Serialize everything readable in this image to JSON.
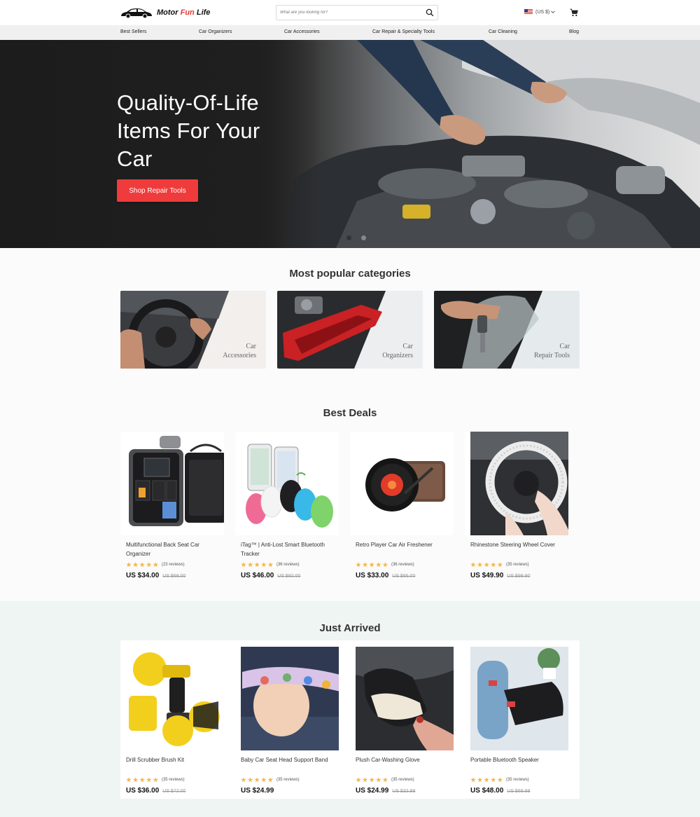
{
  "header": {
    "logo": {
      "word1": "Motor",
      "word2": "Fun",
      "word3": "Life"
    },
    "search": {
      "placeholder": "What are you looking for?",
      "icon": "search-icon"
    },
    "currency": "(US $)",
    "cart_icon": "cart-icon"
  },
  "nav": {
    "items": [
      "Best Sellers",
      "Car Organizers",
      "Car Accessories",
      "Car Repair & Specialty Tools",
      "Car Cleaning",
      "Blog"
    ]
  },
  "hero": {
    "title": "Quality-Of-Life Items For Your Car",
    "cta": "Shop Repair Tools",
    "slides": 2,
    "active_slide": 1
  },
  "categories": {
    "title": "Most popular categories",
    "items": [
      {
        "line1": "Car",
        "line2": "Accessories"
      },
      {
        "line1": "Car",
        "line2": "Organizers"
      },
      {
        "line1": "Car",
        "line2": "Repair Tools"
      }
    ]
  },
  "best_deals": {
    "title": "Best Deals",
    "products": [
      {
        "name": "Multifunctional Back Seat Car Organizer",
        "rating": 5,
        "reviews": "(23 reviews)",
        "price": "US $34.00",
        "old_price": "US $68.00"
      },
      {
        "name": "iTag™ | Anti-Lost Smart Bluetooth Tracker",
        "rating": 5,
        "reviews": "(36 reviews)",
        "price": "US $46.00",
        "old_price": "US $92.00"
      },
      {
        "name": "Retro Player Car Air Freshener",
        "rating": 5,
        "reviews": "(36 reviews)",
        "price": "US $33.00",
        "old_price": "US $66.00"
      },
      {
        "name": "Rhinestone Steering Wheel Cover",
        "rating": 5,
        "reviews": "(35 reviews)",
        "price": "US $49.90",
        "old_price": "US $99.90"
      }
    ]
  },
  "just_arrived": {
    "title": "Just Arrived",
    "products": [
      {
        "name": "Drill Scrubber Brush Kit",
        "rating": 5,
        "reviews": "(35 reviews)",
        "price": "US $36.00",
        "old_price": "US $72.00"
      },
      {
        "name": "Baby Car Seat Head Support Band",
        "rating": 5,
        "reviews": "(35 reviews)",
        "price": "US $24.99",
        "old_price": ""
      },
      {
        "name": "Plush Car-Washing Glove",
        "rating": 5,
        "reviews": "(35 reviews)",
        "price": "US $24.99",
        "old_price": "US $32.99"
      },
      {
        "name": "Portable Bluetooth Speaker",
        "rating": 5,
        "reviews": "(35 reviews)",
        "price": "US $48.00",
        "old_price": "US $69.99"
      }
    ]
  },
  "colors": {
    "accent": "#ef3b3b",
    "star": "#f2b64c",
    "arrived_bg": "#eef5f2"
  }
}
